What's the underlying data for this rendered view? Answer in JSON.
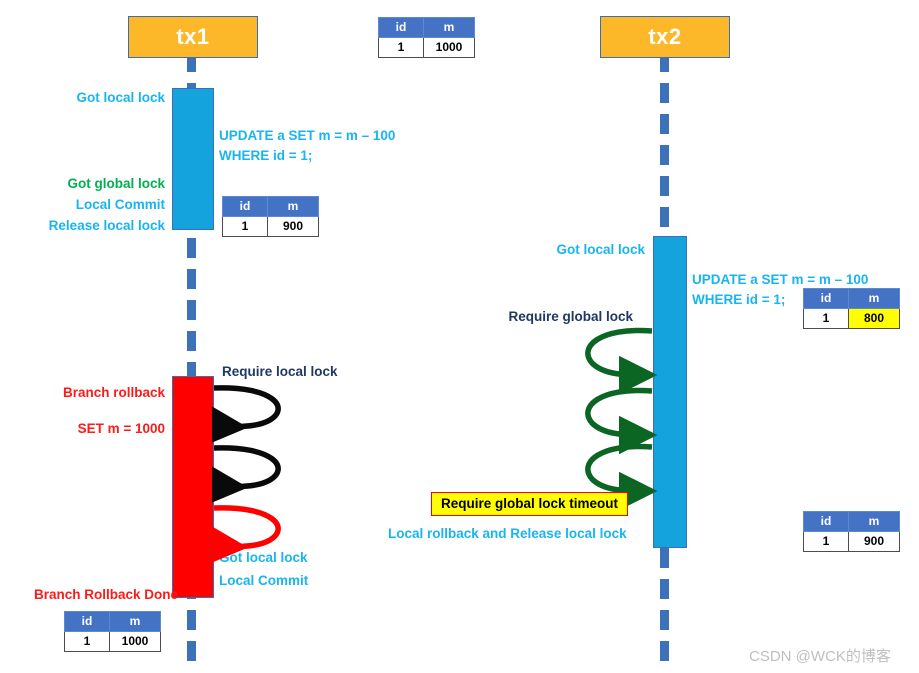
{
  "actors": {
    "tx1": {
      "label": "tx1"
    },
    "tx2": {
      "label": "tx2"
    }
  },
  "tables": {
    "initial": {
      "headers": [
        "id",
        "m"
      ],
      "row": [
        "1",
        "1000"
      ]
    },
    "tx1_after_update": {
      "headers": [
        "id",
        "m"
      ],
      "row": [
        "1",
        "900"
      ]
    },
    "tx1_after_rollback": {
      "headers": [
        "id",
        "m"
      ],
      "row": [
        "1",
        "1000"
      ]
    },
    "tx2_dirty": {
      "headers": [
        "id",
        "m"
      ],
      "row": [
        "1",
        "800"
      ]
    },
    "tx2_final": {
      "headers": [
        "id",
        "m"
      ],
      "row": [
        "1",
        "900"
      ]
    }
  },
  "tx1": {
    "got_local_lock": "Got local lock",
    "sql_line1": "UPDATE a SET m = m – 100",
    "sql_line2": "WHERE id = 1;",
    "got_global_lock": "Got global lock",
    "local_commit": "Local Commit",
    "release_local_lock": "Release local lock",
    "require_local_lock": "Require local lock",
    "branch_rollback": "Branch rollback",
    "set_m": "SET m = 1000",
    "retry_got_local_lock": "Got local lock",
    "retry_local_commit": "Local Commit",
    "branch_rollback_done": "Branch Rollback Done"
  },
  "tx2": {
    "got_local_lock": "Got local lock",
    "sql_line1": "UPDATE a SET m = m – 100",
    "sql_line2": "WHERE id = 1;",
    "require_global_lock": "Require global lock",
    "timeout_callout": "Require global lock timeout",
    "local_rollback": "Local rollback and Release local lock"
  },
  "watermark": {
    "text": "CSDN @WCK的博客"
  },
  "colors": {
    "actor_fill": "#FCB829",
    "bar_active": "#14A3DC",
    "bar_rollback": "#FF0000",
    "lifeline": "#3D72B8",
    "label_blue": "#19B5F0",
    "label_green": "#00B050",
    "label_red": "#FF1A1A",
    "label_navy": "#1F3864",
    "table_header": "#4472C4",
    "highlight": "#FFFF00",
    "arrow_black": "#0A0A0A",
    "arrow_red": "#FF0000",
    "arrow_green": "#0B6623"
  }
}
